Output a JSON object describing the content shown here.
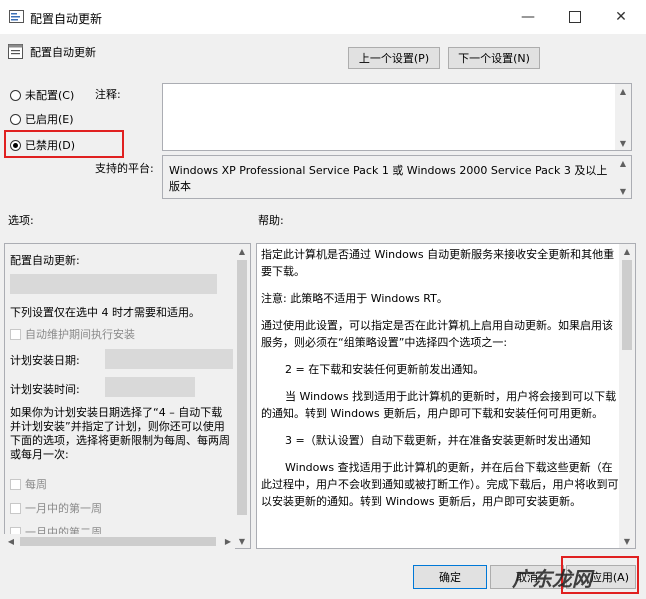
{
  "window": {
    "title": "配置自动更新",
    "minimize_icon": "minimize-icon",
    "maximize_icon": "maximize-icon",
    "close_icon": "close-icon"
  },
  "header": {
    "setting_title": "配置自动更新",
    "prev_button": "上一个设置(P)",
    "next_button": "下一个设置(N)"
  },
  "state": {
    "options": [
      {
        "label": "未配置(C)",
        "selected": false
      },
      {
        "label": "已启用(E)",
        "selected": false
      },
      {
        "label": "已禁用(D)",
        "selected": true
      }
    ]
  },
  "comment": {
    "label": "注释:",
    "value": ""
  },
  "supported": {
    "label": "支持的平台:",
    "value": "Windows XP Professional Service Pack 1 或 Windows 2000 Service Pack 3 及以上版本"
  },
  "options_panel": {
    "label": "选项:",
    "configure_label": "配置自动更新:",
    "note": "下列设置仅在选中 4 时才需要和适用。",
    "maintenance_check": "自动维护期间执行安装",
    "schedule_day_label": "计划安装日期:",
    "schedule_time_label": "计划安装时间:",
    "schedule_note": "如果你为计划安装日期选择了“4 – 自动下载并计划安装”并指定了计划，则你还可以使用下面的选项，选择将更新限制为每周、每两周或每月一次:",
    "weekly_check": "每周",
    "first_week_check": "一月中的第一周",
    "second_week_check": "一月中的第二周"
  },
  "help_panel": {
    "label": "帮助:",
    "paragraphs": [
      "指定此计算机是否通过 Windows 自动更新服务来接收安全更新和其他重要下载。",
      "注意: 此策略不适用于 Windows RT。",
      "通过使用此设置，可以指定是否在此计算机上启用自动更新。如果启用该服务，则必须在“组策略设置”中选择四个选项之一:",
      "2 = 在下载和安装任何更新前发出通知。",
      "当 Windows 找到适用于此计算机的更新时，用户将会接到可以下载的通知。转到 Windows 更新后，用户即可下载和安装任何可用更新。",
      "3 =（默认设置）自动下载更新，并在准备安装更新时发出通知",
      "Windows 查找适用于此计算机的更新，并在后台下载这些更新（在此过程中，用户不会收到通知或被打断工作）。完成下载后，用户将收到可以安装更新的通知。转到 Windows 更新后，用户即可安装更新。"
    ]
  },
  "footer": {
    "ok_button": "确定",
    "cancel_button": "取消",
    "apply_button": "应用(A)",
    "watermark": "广东龙网"
  }
}
